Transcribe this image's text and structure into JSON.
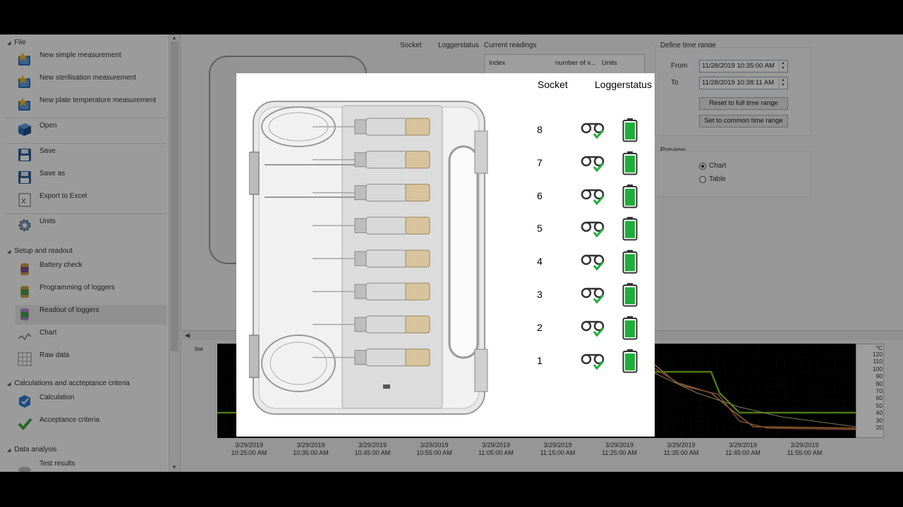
{
  "sidebar": {
    "sections": [
      {
        "label": "File"
      },
      {
        "label": "Setup and readout"
      },
      {
        "label": "Calculations and accteptance criteria"
      },
      {
        "label": "Data analysis"
      }
    ],
    "items": [
      {
        "label": "New simple measurement",
        "icon": "book-star-icon"
      },
      {
        "label": "New sterilisation measurement",
        "icon": "book-star-icon"
      },
      {
        "label": "New plate temperature measurement",
        "icon": "book-star-icon"
      },
      {
        "label": "Open",
        "icon": "open-book-icon"
      },
      {
        "label": "Save",
        "icon": "floppy-disk-icon"
      },
      {
        "label": "Save as",
        "icon": "floppy-disk-icon"
      },
      {
        "label": "Export to Excel",
        "icon": "excel-icon"
      },
      {
        "label": "Units",
        "icon": "gear-icon"
      },
      {
        "label": "Battery check",
        "icon": "logger-battery-icon"
      },
      {
        "label": "Programming of loggers",
        "icon": "logger-program-icon"
      },
      {
        "label": "Readout of loggers",
        "icon": "logger-readout-icon"
      },
      {
        "label": "Chart",
        "icon": "chart-icon"
      },
      {
        "label": "Raw data",
        "icon": "grid-icon"
      },
      {
        "label": "Calculation",
        "icon": "calculation-icon"
      },
      {
        "label": "Acceptance criteria",
        "icon": "checkmark-icon"
      },
      {
        "label": "Test results",
        "icon": "results-icon"
      }
    ]
  },
  "header": {
    "socket": "Socket",
    "loggerstatus": "Loggerstatus",
    "current_readings": "Current readings",
    "readings_cols": [
      "Index",
      "number of v...",
      "Units"
    ]
  },
  "time_range": {
    "title": "Define time range",
    "from_label": "From",
    "from_value": "11/28/2019 10:35:00 AM",
    "to_label": "To",
    "to_value": "11/28/2019 10:38:11 AM",
    "reset_button": "Reset to full time range",
    "common_button": "Set to common time range"
  },
  "preview": {
    "title": "Preview",
    "options": [
      {
        "label": "Chart",
        "selected": true
      },
      {
        "label": "Table",
        "selected": false
      }
    ]
  },
  "chart_data": {
    "type": "line",
    "ylabel_left": "bar",
    "ylabel_right": "°C",
    "right_ticks": [
      "120",
      "110",
      "100",
      "90",
      "80",
      "70",
      "60",
      "50",
      "40",
      "30",
      "20"
    ],
    "x_ticks": [
      {
        "date": "3/29/2019",
        "time": "10:25:00 AM"
      },
      {
        "date": "3/29/2019",
        "time": "10:35:00 AM"
      },
      {
        "date": "3/29/2019",
        "time": "10:45:00 AM"
      },
      {
        "date": "3/29/2019",
        "time": "10:55:00 AM"
      },
      {
        "date": "3/29/2019",
        "time": "11:05:00 AM"
      },
      {
        "date": "3/29/2019",
        "time": "11:15:00 AM"
      },
      {
        "date": "3/29/2019",
        "time": "11:25:00 AM"
      },
      {
        "date": "3/29/2019",
        "time": "11:35:00 AM"
      },
      {
        "date": "3/29/2019",
        "time": "11:45:00 AM"
      },
      {
        "date": "3/29/2019",
        "time": "11:55:00 AM"
      }
    ],
    "series_colors": [
      "#7ec31f",
      "#e8a040",
      "#d0785a",
      "#c9c98a"
    ]
  },
  "modal": {
    "socket_header": "Socket",
    "status_header": "Loggerstatus",
    "sockets": [
      "8",
      "7",
      "6",
      "5",
      "4",
      "3",
      "2",
      "1"
    ],
    "status_icon": "logger-ok-icon",
    "battery_icon": "battery-full-icon",
    "battery_color": "#1fae3a"
  }
}
